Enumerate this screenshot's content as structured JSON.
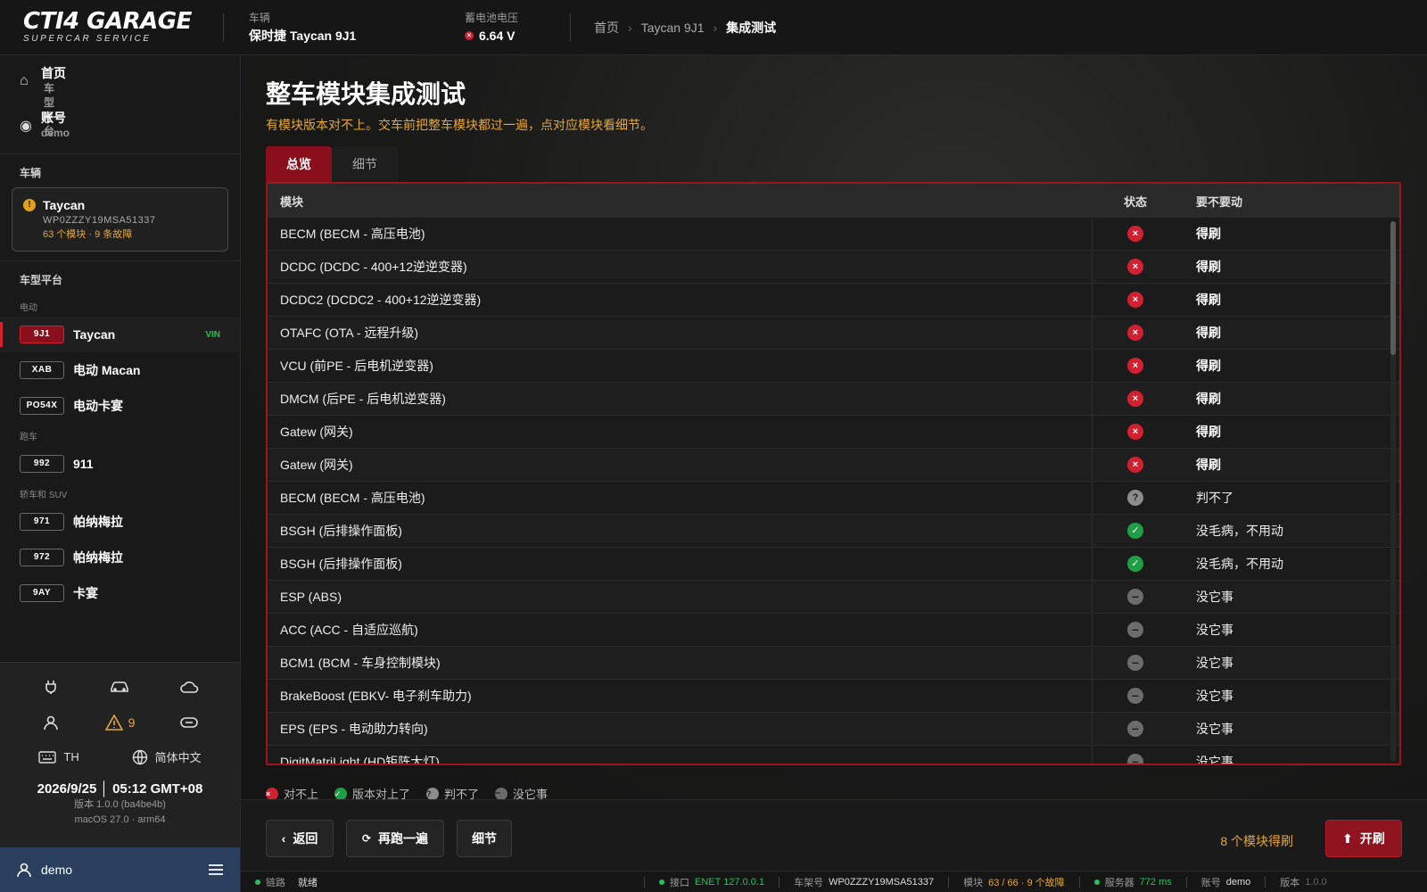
{
  "brand": {
    "line1": "CTI4 GARAGE",
    "line2": "SUPERCAR SERVICE"
  },
  "header": {
    "vehicle_label": "车辆",
    "vehicle_value": "保时捷 Taycan 9J1",
    "voltage_label": "蓄电池电压",
    "voltage_value": "6.64 V",
    "breadcrumb": [
      "首页",
      "Taycan 9J1",
      "集成测试"
    ]
  },
  "sidebar": {
    "nav": [
      {
        "icon": "home-icon",
        "title": "首页",
        "sub": "车型平台"
      },
      {
        "icon": "account-icon",
        "title": "账号",
        "sub": "demo"
      }
    ],
    "vehicle_section": "车辆",
    "vehicle_card": {
      "name": "Taycan",
      "vin": "WP0ZZZY19MSA51337",
      "stats": "63 个模块 · 9 条故障"
    },
    "platform_section": "车型平台",
    "groups": [
      {
        "label": "电动",
        "items": [
          {
            "code": "9J1",
            "name": "Taycan",
            "tag": "VIN",
            "active": true
          },
          {
            "code": "XAB",
            "name": "电动 Macan"
          },
          {
            "code": "PO54X",
            "name": "电动卡宴"
          }
        ]
      },
      {
        "label": "跑车",
        "items": [
          {
            "code": "992",
            "name": "911"
          }
        ]
      },
      {
        "label": "轿车和 SUV",
        "items": [
          {
            "code": "971",
            "name": "帕纳梅拉"
          },
          {
            "code": "972",
            "name": "帕纳梅拉"
          },
          {
            "code": "9AY",
            "name": "卡宴"
          }
        ]
      }
    ],
    "warning_count": "9",
    "keyboard": "TH",
    "language": "简体中文",
    "datetime": "2026/9/25 │ 05:12 GMT+08",
    "version": "版本 1.0.0 (ba4be4b)",
    "os": "macOS 27.0 · arm64",
    "user": "demo"
  },
  "main": {
    "title": "整车模块集成测试",
    "subtitle": "有模块版本对不上。交车前把整车模块都过一遍，点对应模块看细节。",
    "tabs": [
      "总览",
      "细节"
    ],
    "columns": {
      "module": "模块",
      "status": "状态",
      "action": "要不要动"
    },
    "rows": [
      {
        "module": "BECM (BECM - 高压电池)",
        "status": "x",
        "action": "得刷"
      },
      {
        "module": "DCDC (DCDC - 400+12逆逆变器)",
        "status": "x",
        "action": "得刷"
      },
      {
        "module": "DCDC2 (DCDC2 - 400+12逆逆变器)",
        "status": "x",
        "action": "得刷"
      },
      {
        "module": "OTAFC (OTA - 远程升级)",
        "status": "x",
        "action": "得刷"
      },
      {
        "module": "VCU (前PE - 后电机逆变器)",
        "status": "x",
        "action": "得刷"
      },
      {
        "module": "DMCM (后PE - 后电机逆变器)",
        "status": "x",
        "action": "得刷"
      },
      {
        "module": "Gatew (网关)",
        "status": "x",
        "action": "得刷"
      },
      {
        "module": "Gatew (网关)",
        "status": "x",
        "action": "得刷"
      },
      {
        "module": "BECM (BECM - 高压电池)",
        "status": "q",
        "action": "判不了"
      },
      {
        "module": "BSGH (后排操作面板)",
        "status": "ok",
        "action": "没毛病，不用动"
      },
      {
        "module": "BSGH (后排操作面板)",
        "status": "ok",
        "action": "没毛病，不用动"
      },
      {
        "module": "ESP (ABS)",
        "status": "na",
        "action": "没它事"
      },
      {
        "module": "ACC (ACC - 自适应巡航)",
        "status": "na",
        "action": "没它事"
      },
      {
        "module": "BCM1 (BCM - 车身控制模块)",
        "status": "na",
        "action": "没它事"
      },
      {
        "module": "BrakeBoost (EBKV- 电子刹车助力)",
        "status": "na",
        "action": "没它事"
      },
      {
        "module": "EPS (EPS - 电动助力转向)",
        "status": "na",
        "action": "没它事"
      },
      {
        "module": "DigitMatriLight (HD矩阵大灯)",
        "status": "na",
        "action": "没它事"
      }
    ],
    "legend": {
      "x": "对不上",
      "ok": "版本对上了",
      "q": "判不了",
      "na": "没它事"
    }
  },
  "actions": {
    "back": "返回",
    "rerun": "再跑一遍",
    "detail": "细节",
    "flash_note": "8 个模块得刷",
    "flash": "开刷"
  },
  "statusbar": {
    "link_label": "链路",
    "link_value": "就绪",
    "iface_label": "接口",
    "iface_value": "ENET 127.0.0.1",
    "vin_label": "车架号",
    "vin_value": "WP0ZZZY19MSA51337",
    "mod_label": "模块",
    "mod_value": "63 / 66 · 9 个故障",
    "server_label": "服务器",
    "server_value": "772 ms",
    "acct_label": "账号",
    "acct_value": "demo",
    "ver_label": "版本",
    "ver_value": "1.0.0"
  }
}
